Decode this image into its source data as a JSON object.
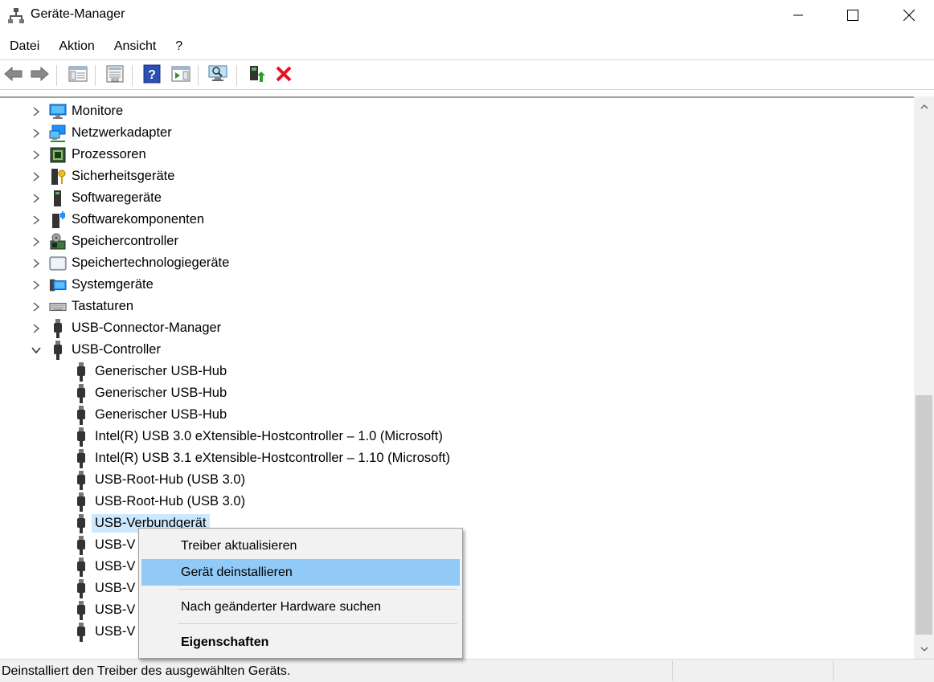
{
  "window": {
    "title": "Geräte-Manager",
    "icon": "device-manager-icon"
  },
  "menu": [
    "Datei",
    "Aktion",
    "Ansicht",
    "?"
  ],
  "toolbar": {
    "buttons": [
      "back-icon",
      "forward-icon",
      "show-hide-tree-icon",
      "properties-icon",
      "help-icon",
      "action-pane-icon",
      "scan-hardware-icon",
      "update-driver-icon",
      "uninstall-icon"
    ]
  },
  "tree": {
    "categories": [
      {
        "label": "Monitore",
        "icon": "monitor-icon",
        "expanded": false
      },
      {
        "label": "Netzwerkadapter",
        "icon": "network-adapter-icon",
        "expanded": false
      },
      {
        "label": "Prozessoren",
        "icon": "processor-icon",
        "expanded": false
      },
      {
        "label": "Sicherheitsgeräte",
        "icon": "security-device-icon",
        "expanded": false
      },
      {
        "label": "Softwaregeräte",
        "icon": "software-device-icon",
        "expanded": false
      },
      {
        "label": "Softwarekomponenten",
        "icon": "software-component-icon",
        "expanded": false
      },
      {
        "label": "Speichercontroller",
        "icon": "storage-controller-icon",
        "expanded": false
      },
      {
        "label": "Speichertechnologiegeräte",
        "icon": "memory-technology-icon",
        "expanded": false
      },
      {
        "label": "Systemgeräte",
        "icon": "system-device-icon",
        "expanded": false
      },
      {
        "label": "Tastaturen",
        "icon": "keyboard-icon",
        "expanded": false
      },
      {
        "label": "USB-Connector-Manager",
        "icon": "usb-icon",
        "expanded": false
      },
      {
        "label": "USB-Controller",
        "icon": "usb-icon",
        "expanded": true
      }
    ],
    "usb_children": [
      "Generischer USB-Hub",
      "Generischer USB-Hub",
      "Generischer USB-Hub",
      "Intel(R) USB 3.0 eXtensible-Hostcontroller – 1.0 (Microsoft)",
      "Intel(R) USB 3.1 eXtensible-Hostcontroller – 1.10 (Microsoft)",
      "USB-Root-Hub (USB 3.0)",
      "USB-Root-Hub (USB 3.0)",
      "USB-Verbundgerät",
      "USB-V",
      "USB-V",
      "USB-V",
      "USB-V",
      "USB-V"
    ],
    "selected": "USB-Verbundgerät"
  },
  "context_menu": {
    "items": [
      {
        "label": "Treiber aktualisieren",
        "highlighted": false,
        "bold": false
      },
      {
        "label": "Gerät deinstallieren",
        "highlighted": true,
        "bold": false
      },
      {
        "label": "Nach geänderter Hardware suchen",
        "highlighted": false,
        "bold": false
      },
      {
        "label": "Eigenschaften",
        "highlighted": false,
        "bold": true
      }
    ]
  },
  "status": {
    "text": "Deinstalliert den Treiber des ausgewählten Geräts."
  },
  "colors": {
    "selection": "#cce8ff",
    "menu_highlight": "#91c9f7",
    "uninstall_red": "#e81123"
  }
}
